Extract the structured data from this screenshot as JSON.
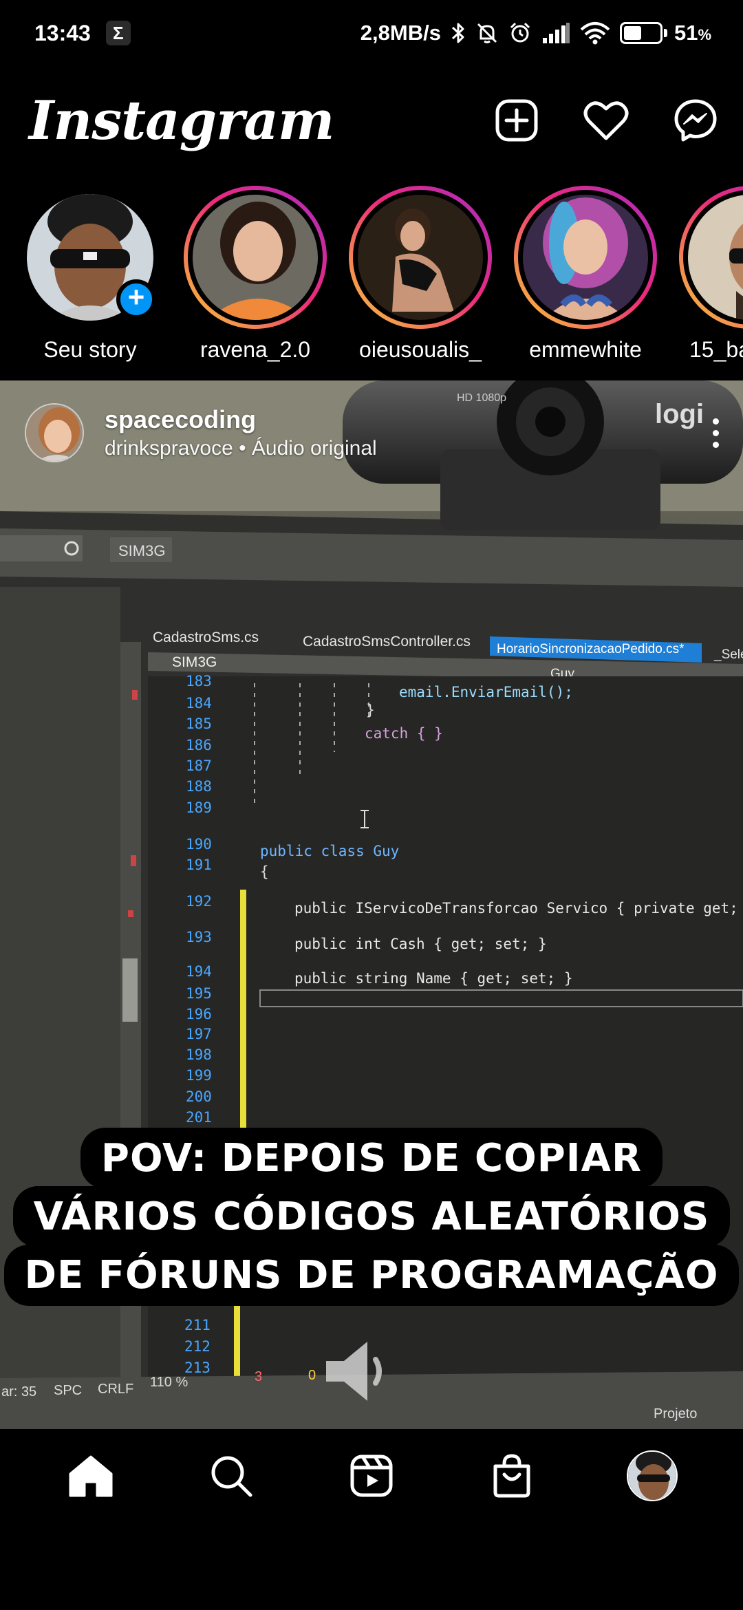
{
  "status_bar": {
    "time": "13:43",
    "sigma": "Σ",
    "net_speed": "2,8MB/s",
    "battery_percent": "51",
    "battery_unit": "%",
    "battery_level": 0.51
  },
  "header": {
    "logo": "Instagram",
    "icons": [
      "plus-square-icon",
      "heart-icon",
      "messenger-icon"
    ]
  },
  "stories": [
    {
      "name": "Seu story",
      "own": true
    },
    {
      "name": "ravena_2.0"
    },
    {
      "name": "oieusoualis_"
    },
    {
      "name": "emmewhite"
    },
    {
      "name": "15_ba"
    }
  ],
  "post": {
    "username": "spacecoding",
    "subtitle": "drinkspravoce • Áudio original",
    "caption_lines": [
      "POV: DEPOIS DE COPIAR",
      "VÁRIOS CÓDIGOS ALEATÓRIOS",
      "DE FÓRUNS DE PROGRAMAÇÃO"
    ],
    "video": {
      "webcam_label": "HD 1080p",
      "webcam_brand": "logi",
      "toolbar_label": "SIM3G",
      "tabs": [
        "CadastroSms.cs",
        "CadastroSmsController.cs",
        "HorarioSincronizacaoPedido.cs*",
        "_Selec"
      ],
      "project_label": "SIM3G",
      "member_label": "Guy",
      "line_numbers": [
        "183",
        "184",
        "185",
        "186",
        "187",
        "188",
        "189",
        "190",
        "191",
        "192",
        "193",
        "194",
        "195",
        "196",
        "197",
        "198",
        "199",
        "200",
        "201",
        "211",
        "212",
        "213"
      ],
      "code": {
        "l184": "email.EnviarEmail();",
        "l185": "}",
        "l186": "catch { }",
        "l190": "public class Guy",
        "l191": "{",
        "l192": "public IServicoDeTransforcao Servico { private get; init;",
        "l193": "public int Cash { get; set; }",
        "l194": "public string Name { get; set; }"
      },
      "status_items": [
        "ar: 35",
        "SPC",
        "CRLF",
        "110 %",
        "3",
        "0"
      ],
      "solution_label": "Projeto"
    }
  },
  "bottom_nav": [
    "home-icon",
    "search-icon",
    "reels-icon",
    "shop-icon",
    "profile-avatar"
  ]
}
